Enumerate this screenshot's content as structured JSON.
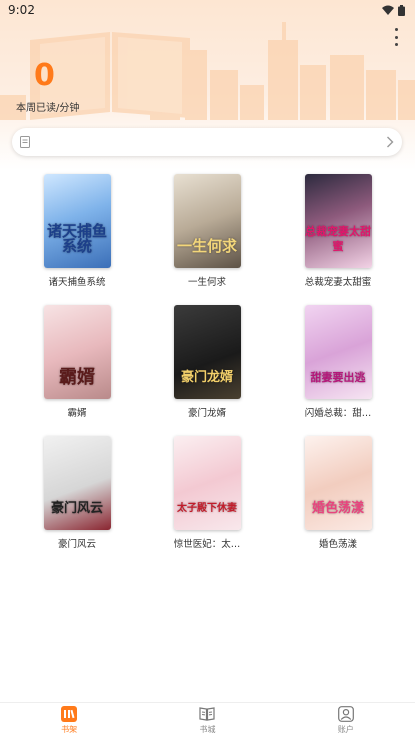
{
  "status_bar": {
    "time": "9:02"
  },
  "reading": {
    "count": "0",
    "label": "本周已读/分钟"
  },
  "search": {
    "placeholder": ""
  },
  "books": [
    {
      "title": "诸天捕鱼系统",
      "cover_text": "诸天捕鱼系统"
    },
    {
      "title": "一生何求",
      "cover_text": "一生何求"
    },
    {
      "title": "总裁宠妻太甜蜜",
      "cover_text": "总裁宠妻太甜蜜"
    },
    {
      "title": "霸婿",
      "cover_text": "霸婿"
    },
    {
      "title": "豪门龙婿",
      "cover_text": "豪门龙婿"
    },
    {
      "title": "闪婚总裁：甜…",
      "cover_text": "甜妻要出逃"
    },
    {
      "title": "豪门风云",
      "cover_text": "豪门风云"
    },
    {
      "title": "惊世医妃：太…",
      "cover_text": "太子殿下休妻"
    },
    {
      "title": "婚色荡漾",
      "cover_text": "婚色荡漾"
    }
  ],
  "nav": [
    {
      "label": "书架",
      "icon": "bookshelf-icon",
      "active": true
    },
    {
      "label": "书城",
      "icon": "bookstore-icon",
      "active": false
    },
    {
      "label": "账户",
      "icon": "account-icon",
      "active": false
    }
  ],
  "colors": {
    "accent": "#ff7a1a",
    "header_bg": "#fde6d2"
  }
}
